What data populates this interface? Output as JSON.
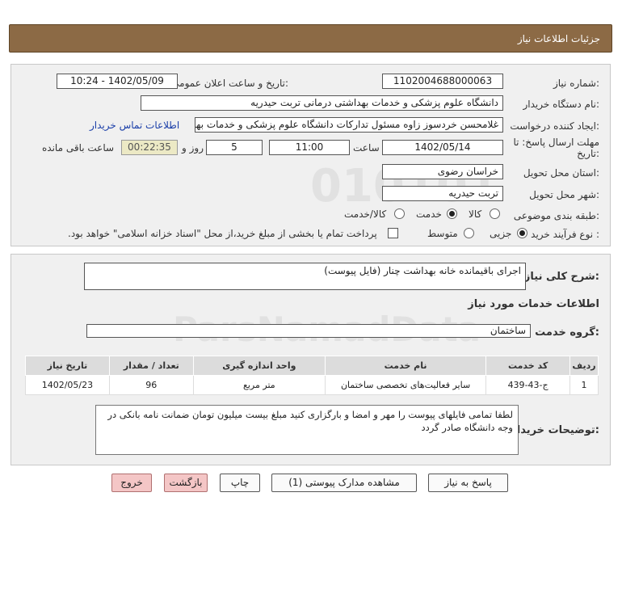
{
  "header": {
    "title": "جزئیات اطلاعات نیاز"
  },
  "form": {
    "need_number_label": "شماره نیاز:",
    "need_number": "1102004688000063",
    "announce_label": "تاریخ و ساعت اعلان عمومی:",
    "announce_value": "1402/05/09 - 10:24",
    "buyer_org_label": "نام دستگاه خریدار:",
    "buyer_org": "دانشگاه علوم پزشکی و خدمات بهداشتی درمانی تربت حیدریه",
    "creator_label": "ایجاد کننده درخواست:",
    "creator": "غلامحسن خردسوز زاوه مسئول تدارکات دانشگاه علوم پزشکی و خدمات بهداشتی",
    "contact_link": "اطلاعات تماس خریدار",
    "deadline_label_1": "مهلت ارسال پاسخ: تا",
    "deadline_label_2": "تاریخ:",
    "deadline_date": "1402/05/14",
    "time_label": "ساعت",
    "deadline_time": "11:00",
    "days_value": "5",
    "days_label": "روز و",
    "remaining_time": "00:22:35",
    "remaining_label": "ساعت باقی مانده",
    "province_label": "استان محل تحویل:",
    "province": "خراسان رضوی",
    "city_label": "شهر محل تحویل:",
    "city": "تربت حیدریه",
    "category_label": "طبقه بندی موضوعی:",
    "category_options": [
      "کالا",
      "خدمت",
      "کالا/خدمت"
    ],
    "category_selected": "خدمت",
    "process_label": "نوع فرآیند خرید :",
    "process_options": [
      "جزیی",
      "متوسط"
    ],
    "process_selected": "جزیی",
    "payment_note": "پرداخت تمام یا بخشی از مبلغ خرید،از محل \"اسناد خزانه اسلامی\" خواهد بود."
  },
  "details": {
    "summary_label": "شرح کلی نیاز:",
    "summary": "اجرای باقیمانده خانه بهداشت چنار (فایل پیوست)",
    "services_heading": "اطلاعات خدمات مورد نیاز",
    "service_group_label": "گروه خدمت:",
    "service_group": "ساختمان",
    "table": {
      "headers": [
        "ردیف",
        "کد خدمت",
        "نام خدمت",
        "واحد اندازه گیری",
        "تعداد / مقدار",
        "تاریخ نیاز"
      ],
      "rows": [
        [
          "1",
          "ج-43-439",
          "سایر فعالیت‌های تخصصی ساختمان",
          "متر مربع",
          "96",
          "1402/05/23"
        ]
      ]
    },
    "buyer_notes_label": "توضیحات خریدار:",
    "buyer_notes": "لطفا تمامی فایلهای پیوست را مهر و امضا و بارگزاری کنید مبلغ بیست میلیون تومان  ضمانت  نامه بانکی در وجه دانشگاه صادر گردد"
  },
  "buttons": {
    "reply": "پاسخ به نیاز",
    "attachments": "مشاهده مدارک پیوستی (1)",
    "print": "چاپ",
    "back": "بازگشت",
    "exit": "خروج"
  },
  "watermark": {
    "brand": "ParsNamadData"
  }
}
